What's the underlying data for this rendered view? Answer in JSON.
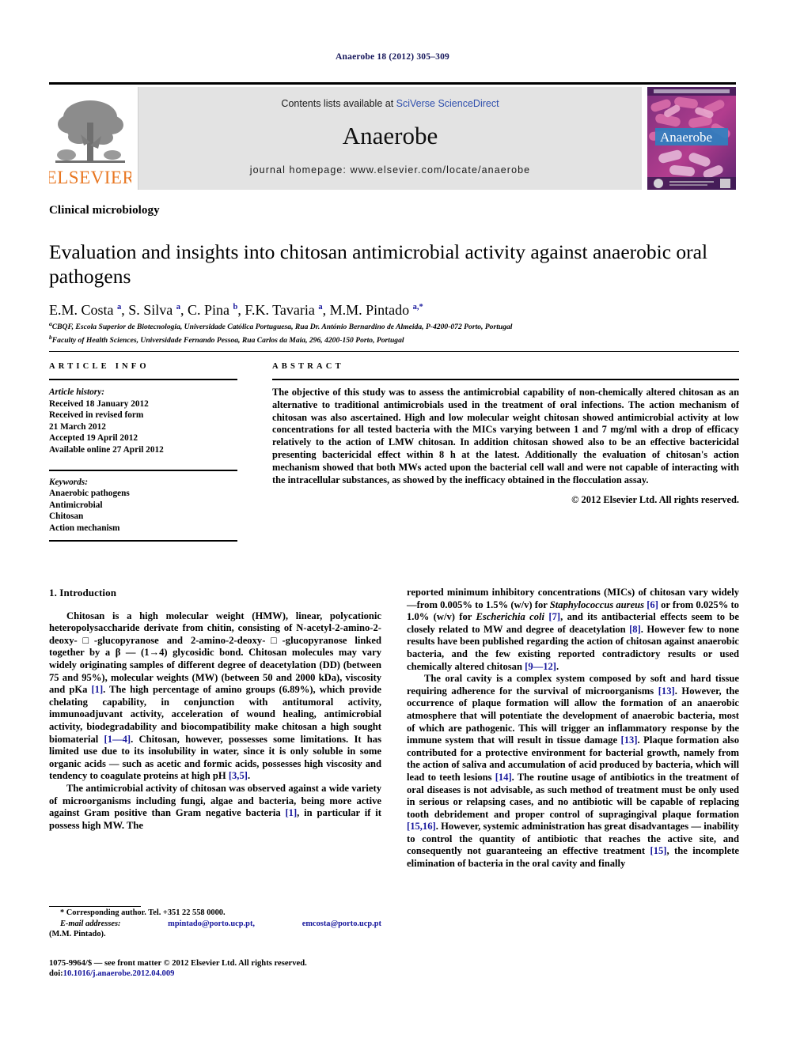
{
  "running_head": "Anaerobe 18 (2012) 305–309",
  "masthead": {
    "contents_prefix": "Contents lists available at ",
    "sciencedirect_link": "SciVerse ScienceDirect",
    "journal_name": "Anaerobe",
    "homepage": "journal homepage: www.elsevier.com/locate/anaerobe",
    "publisher_wordmark": "ELSEVIER",
    "cover_title": "Anaerobe",
    "accent_link_color": "#2f4fad",
    "elsevier_orange": "#e87722"
  },
  "section_label": "Clinical microbiology",
  "title": "Evaluation and insights into chitosan antimicrobial activity against anaerobic oral pathogens",
  "authors_html": "E.M. Costa <sup>a</sup>, S. Silva <sup>a</sup>, C. Pina <sup>b</sup>, F.K. Tavaria <sup>a</sup>, M.M. Pintado <sup>a,*</sup>",
  "affiliations": [
    {
      "marker": "a",
      "text": "CBQF, Escola Superior de Biotecnologia, Universidade Católica Portuguesa, Rua Dr. António Bernardino de Almeida, P-4200-072 Porto, Portugal"
    },
    {
      "marker": "b",
      "text": "Faculty of Health Sciences, Universidade Fernando Pessoa, Rua Carlos da Maia, 296, 4200-150 Porto, Portugal"
    }
  ],
  "article_info": {
    "heading": "ARTICLE INFO",
    "history_label": "Article history:",
    "history": [
      "Received 18 January 2012",
      "Received in revised form",
      "21 March 2012",
      "Accepted 19 April 2012",
      "Available online 27 April 2012"
    ],
    "keywords_label": "Keywords:",
    "keywords": [
      "Anaerobic pathogens",
      "Antimicrobial",
      "Chitosan",
      "Action mechanism"
    ]
  },
  "abstract": {
    "heading": "ABSTRACT",
    "text": "The objective of this study was to assess the antimicrobial capability of non-chemically altered chitosan as an alternative to traditional antimicrobials used in the treatment of oral infections. The action mechanism of chitosan was also ascertained. High and low molecular weight chitosan showed antimicrobial activity at low concentrations for all tested bacteria with the MICs varying between 1 and 7 mg/ml with a drop of efficacy relatively to the action of LMW chitosan. In addition chitosan showed also to be an effective bactericidal presenting bactericidal effect within 8 h at the latest. Additionally the evaluation of chitosan's action mechanism showed that both MWs acted upon the bacterial cell wall and were not capable of interacting with the intracellular substances, as showed by the inefficacy obtained in the flocculation assay.",
    "copyright": "© 2012 Elsevier Ltd. All rights reserved."
  },
  "body": {
    "intro_heading": "1. Introduction",
    "left_paragraphs": [
      "Chitosan is a high molecular weight (HMW), linear, polycationic heteropolysaccharide derivate from chitin, consisting of N-acetyl-2-amino-2-deoxy-□-glucopyranose and 2-amino-2-deoxy-□-glucopyranose linked together by a β — (1→4) glycosidic bond. Chitosan molecules may vary widely originating samples of different degree of deacetylation (DD) (between 75 and 95%), molecular weights (MW) (between 50 and 2000 kDa), viscosity and pKa [1]. The high percentage of amino groups (6.89%), which provide chelating capability, in conjunction with antitumoral activity, immunoadjuvant activity, acceleration of wound healing, antimicrobial activity, biodegradability and biocompatibility make chitosan a high sought biomaterial [1—4]. Chitosan, however, possesses some limitations. It has limited use due to its insolubility in water, since it is only soluble in some organic acids — such as acetic and formic acids, possesses high viscosity and tendency to coagulate proteins at high pH [3,5].",
      "The antimicrobial activity of chitosan was observed against a wide variety of microorganisms including fungi, algae and bacteria, being more active against Gram positive than Gram negative bacteria [1], in particular if it possess high MW. The"
    ],
    "right_paragraphs": [
      "reported minimum inhibitory concentrations (MICs) of chitosan vary widely—from 0.005% to 1.5% (w/v) for Staphylococcus aureus [6] or from 0.025% to 1.0% (w/v) for Escherichia coli [7], and its antibacterial effects seem to be closely related to MW and degree of deacetylation [8]. However few to none results have been published regarding the action of chitosan against anaerobic bacteria, and the few existing reported contradictory results or used chemically altered chitosan [9—12].",
      "The oral cavity is a complex system composed by soft and hard tissue requiring adherence for the survival of microorganisms [13]. However, the occurrence of plaque formation will allow the formation of an anaerobic atmosphere that will potentiate the development of anaerobic bacteria, most of which are pathogenic. This will trigger an inflammatory response by the immune system that will result in tissue damage [13]. Plaque formation also contributed for a protective environment for bacterial growth, namely from the action of saliva and accumulation of acid produced by bacteria, which will lead to teeth lesions [14]. The routine usage of antibiotics in the treatment of oral diseases is not advisable, as such method of treatment must be only used in serious or relapsing cases, and no antibiotic will be capable of replacing tooth debridement and proper control of supragingival plaque formation [15,16]. However, systemic administration has great disadvantages — inability to control the quantity of antibiotic that reaches the active site, and consequently not guaranteeing an effective treatment [15], the incomplete elimination of bacteria in the oral cavity and finally"
    ]
  },
  "footnote": {
    "corresponding": "* Corresponding author. Tel. +351 22 558 0000.",
    "email_label": "E-mail addresses:",
    "email_1": "mpintado@porto.ucp.pt,",
    "email_2": "emcosta@porto.ucp.pt",
    "email_owner": "(M.M. Pintado)."
  },
  "imprint": {
    "line1": "1075-9964/$ — see front matter © 2012 Elsevier Ltd. All rights reserved.",
    "doi_label": "doi:",
    "doi_value": "10.1016/j.anaerobe.2012.04.009"
  }
}
